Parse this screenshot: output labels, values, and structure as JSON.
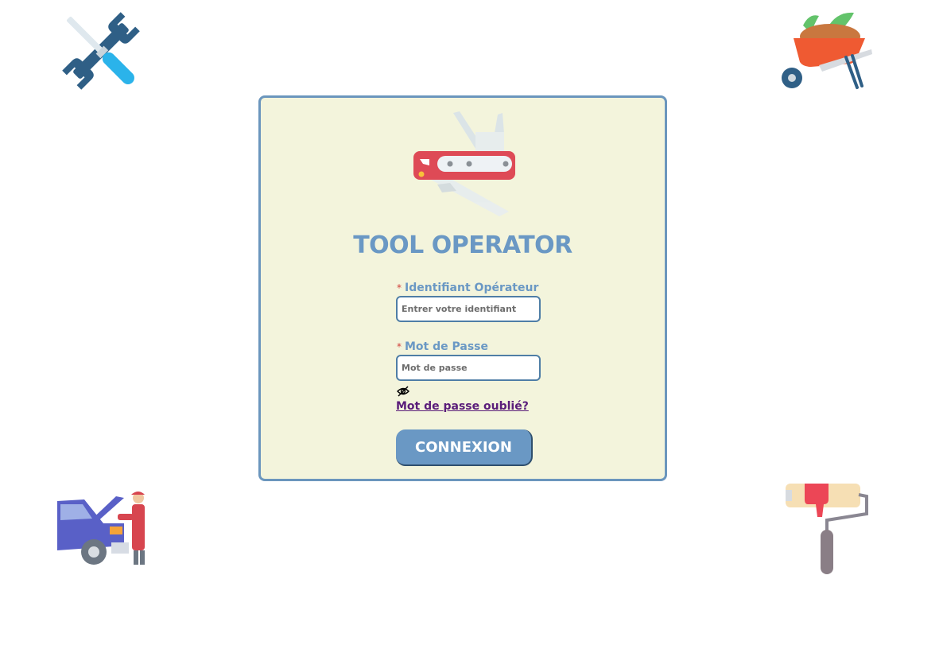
{
  "app": {
    "title": "TOOL OPERATOR"
  },
  "login": {
    "required_mark": "*",
    "username": {
      "label": "Identifiant Opérateur",
      "placeholder": "Entrer votre identifiant",
      "value": ""
    },
    "password": {
      "label": "Mot de Passe",
      "placeholder": "Mot de passe",
      "value": ""
    },
    "toggle_visibility_icon": "eye-slash-icon",
    "forgot_password": "Mot de passe oublié?",
    "submit_label": "CONNEXION"
  },
  "decorations": {
    "top_left": "wrench-screwdriver-icon",
    "top_right": "wheelbarrow-icon",
    "bottom_left": "car-mechanic-icon",
    "bottom_right": "paint-roller-icon",
    "logo": "swiss-knife-icon"
  },
  "colors": {
    "primary": "#6a98c4",
    "card_bg": "#f3f4dc",
    "card_border": "#6b96bd",
    "required": "#d0413b",
    "link": "#5a1d7a"
  }
}
